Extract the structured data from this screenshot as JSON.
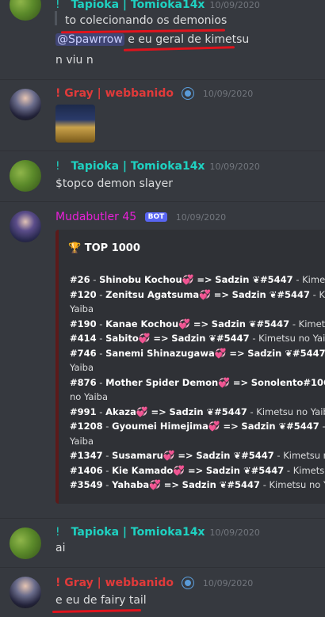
{
  "messages": [
    {
      "username": "Tapioka | Tomioka14x",
      "prefix": "!",
      "timestamp": "10/09/2020",
      "lines": [
        "to colecionando os demonios",
        "e eu geral de kimetsu",
        "n viu n"
      ],
      "mention": "@Spawrrow"
    },
    {
      "username": "! Gray | webbanido",
      "timestamp": "10/09/2020"
    },
    {
      "username": "Tapioka | Tomioka14x",
      "prefix": "!",
      "timestamp": "10/09/2020",
      "lines": [
        "$topco demon slayer"
      ]
    },
    {
      "username": "Mudabutler 45",
      "bot_tag": "BOT",
      "timestamp": "10/09/2020"
    },
    {
      "username": "Tapioka | Tomioka14x",
      "prefix": "!",
      "timestamp": "10/09/2020",
      "lines": [
        "ai"
      ]
    },
    {
      "username": "! Gray | webbanido",
      "timestamp": "10/09/2020",
      "lines": [
        "e eu de fairy tail"
      ]
    }
  ],
  "embed": {
    "title_icon": "🏆",
    "title": "TOP 1000",
    "rows": [
      {
        "rank": "#26",
        "name": "Shinobu Kochou",
        "owner": "Sadzin ❦#5447",
        "tail": " - Kimets"
      },
      {
        "rank": "#120",
        "name": "Zenitsu Agatsuma",
        "owner": "Sadzin ❦#5447",
        "tail": " - Kim"
      },
      {
        "wrap": "Yaiba"
      },
      {
        "rank": "#190",
        "name": "Kanae Kochou",
        "owner": "Sadzin ❦#5447",
        "tail": " - Kimetsu"
      },
      {
        "rank": "#414",
        "name": "Sabito",
        "owner": "Sadzin ❦#5447",
        "tail": " - Kimetsu no Yaib"
      },
      {
        "rank": "#746",
        "name": "Sanemi Shinazugawa",
        "owner": "Sadzin ❦#5447",
        "tail": " - K"
      },
      {
        "wrap": "Yaiba"
      },
      {
        "rank": "#876",
        "name": "Mother Spider Demon",
        "owner": "Sonolento#1061",
        "tail": " -"
      },
      {
        "wrap": "no Yaiba"
      },
      {
        "rank": "#991",
        "name": "Akaza",
        "owner": "Sadzin ❦#5447",
        "tail": " - Kimetsu no Yaib"
      },
      {
        "rank": "#1208",
        "name": "Gyoumei Himejima",
        "owner": "Sadzin ❦#5447",
        "tail": " - K"
      },
      {
        "wrap": "Yaiba"
      },
      {
        "rank": "#1347",
        "name": "Susamaru",
        "owner": "Sadzin ❦#5447",
        "tail": " - Kimetsu no"
      },
      {
        "rank": "#1406",
        "name": "Kie Kamado",
        "owner": "Sadzin ❦#5447",
        "tail": " - Kimetsu"
      },
      {
        "rank": "#3549",
        "name": "Yahaba",
        "owner": "Sadzin ❦#5447",
        "tail": " - Kimetsu no Y"
      }
    ],
    "arrow": "=>",
    "heart": "💞"
  },
  "colors": {
    "tapioka": "#1fd1c1",
    "gray": "#e03a3a",
    "mudabutler": "#e91fd9",
    "annotation": "#e0131c"
  },
  "icons": {
    "verified": "verified-badge-icon",
    "trophy": "trophy-icon"
  }
}
